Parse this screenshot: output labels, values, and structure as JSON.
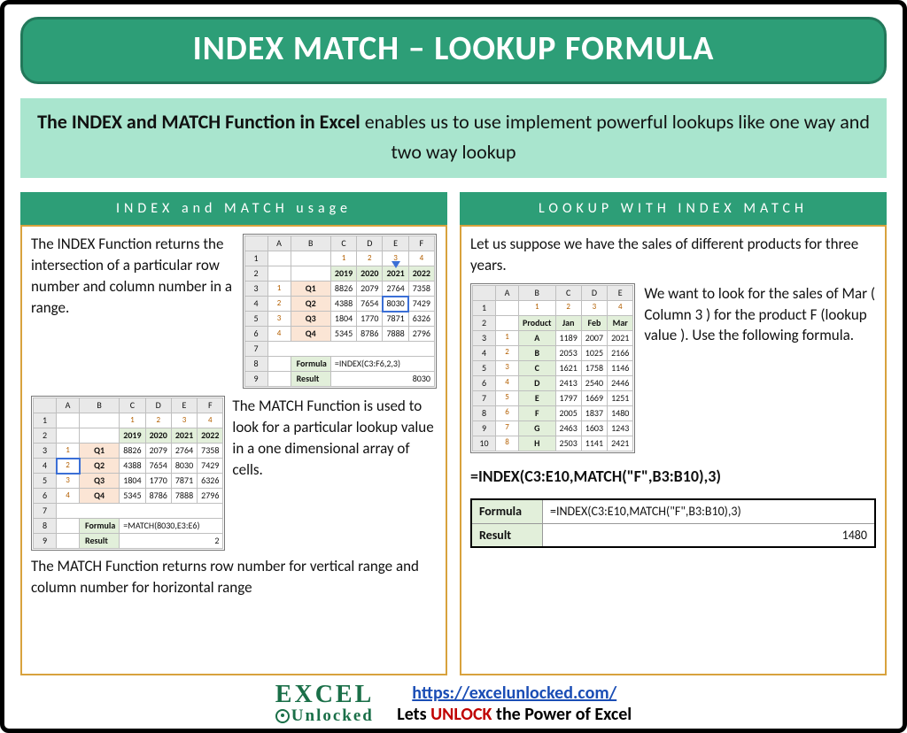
{
  "title": "INDEX MATCH – LOOKUP FORMULA",
  "subtitle_bold": "The INDEX and MATCH Function in Excel ",
  "subtitle_rest": "enables us to use implement powerful lookups like one way and two way lookup",
  "left": {
    "header": "INDEX and MATCH usage",
    "text_index": "The INDEX Function returns the intersection of a particular row number and column number in a range.",
    "text_match": "The MATCH Function is used to look for a particular lookup value in a one dimensional array of cells.",
    "text_match2": "The MATCH Function returns row number for vertical range and column number for horizontal range",
    "table_index": {
      "cols": [
        "A",
        "B",
        "C",
        "D",
        "E",
        "F"
      ],
      "idx": [
        "1",
        "2",
        "3",
        "4"
      ],
      "years": [
        "2019",
        "2020",
        "2021",
        "2022"
      ],
      "rows": [
        {
          "q": "Q1",
          "v": [
            "8826",
            "2079",
            "2764",
            "7358"
          ]
        },
        {
          "q": "Q2",
          "v": [
            "4388",
            "7654",
            "8030",
            "7429"
          ]
        },
        {
          "q": "Q3",
          "v": [
            "1804",
            "1770",
            "7871",
            "6326"
          ]
        },
        {
          "q": "Q4",
          "v": [
            "5345",
            "8786",
            "7888",
            "2796"
          ]
        }
      ],
      "formula_label": "Formula",
      "formula": "=INDEX(C3:F6,2,3)",
      "result_label": "Result",
      "result": "8030"
    },
    "table_match": {
      "cols": [
        "A",
        "B",
        "C",
        "D",
        "E",
        "F"
      ],
      "idx": [
        "1",
        "2",
        "3",
        "4"
      ],
      "years": [
        "2019",
        "2020",
        "2021",
        "2022"
      ],
      "rows": [
        {
          "q": "Q1",
          "v": [
            "8826",
            "2079",
            "2764",
            "7358"
          ]
        },
        {
          "q": "Q2",
          "v": [
            "4388",
            "7654",
            "8030",
            "7429"
          ]
        },
        {
          "q": "Q3",
          "v": [
            "1804",
            "1770",
            "7871",
            "6326"
          ]
        },
        {
          "q": "Q4",
          "v": [
            "5345",
            "8786",
            "7888",
            "2796"
          ]
        }
      ],
      "formula_label": "Formula",
      "formula": "=MATCH(8030,E3:E6)",
      "result_label": "Result",
      "result": "2"
    }
  },
  "right": {
    "header": "LOOKUP WITH INDEX MATCH",
    "intro": "Let us suppose we have the sales of different products for three years.",
    "side_text": "We want to look for the sales of Mar ( Column 3 ) for the product F (lookup value ). Use the following formula.",
    "formula_big": "=INDEX(C3:E10,MATCH(\"F\",B3:B10),3)",
    "table_products": {
      "cols": [
        "A",
        "B",
        "C",
        "D",
        "E"
      ],
      "idx": [
        "1",
        "2",
        "3",
        "4",
        "5",
        "6",
        "7",
        "8"
      ],
      "header_row": [
        "Product",
        "Jan",
        "Feb",
        "Mar"
      ],
      "rows": [
        {
          "p": "A",
          "v": [
            "1189",
            "2007",
            "2021"
          ]
        },
        {
          "p": "B",
          "v": [
            "2053",
            "1025",
            "2166"
          ]
        },
        {
          "p": "C",
          "v": [
            "1621",
            "1758",
            "1146"
          ]
        },
        {
          "p": "D",
          "v": [
            "2413",
            "2540",
            "2446"
          ]
        },
        {
          "p": "E",
          "v": [
            "1797",
            "1669",
            "1251"
          ]
        },
        {
          "p": "F",
          "v": [
            "2005",
            "1837",
            "1480"
          ]
        },
        {
          "p": "G",
          "v": [
            "2463",
            "1603",
            "1243"
          ]
        },
        {
          "p": "H",
          "v": [
            "2503",
            "1141",
            "2421"
          ]
        }
      ]
    },
    "result": {
      "formula_label": "Formula",
      "formula": "=INDEX(C3:E10,MATCH(\"F\",B3:B10),3)",
      "result_label": "Result",
      "result": "1480"
    }
  },
  "footer": {
    "logo_line1": "EXCEL",
    "logo_line2": "Unlocked",
    "url": "https://excelunlocked.com/",
    "tag_pre": "Lets ",
    "tag_unlock": "UNLOCK",
    "tag_post": " the Power of Excel"
  }
}
